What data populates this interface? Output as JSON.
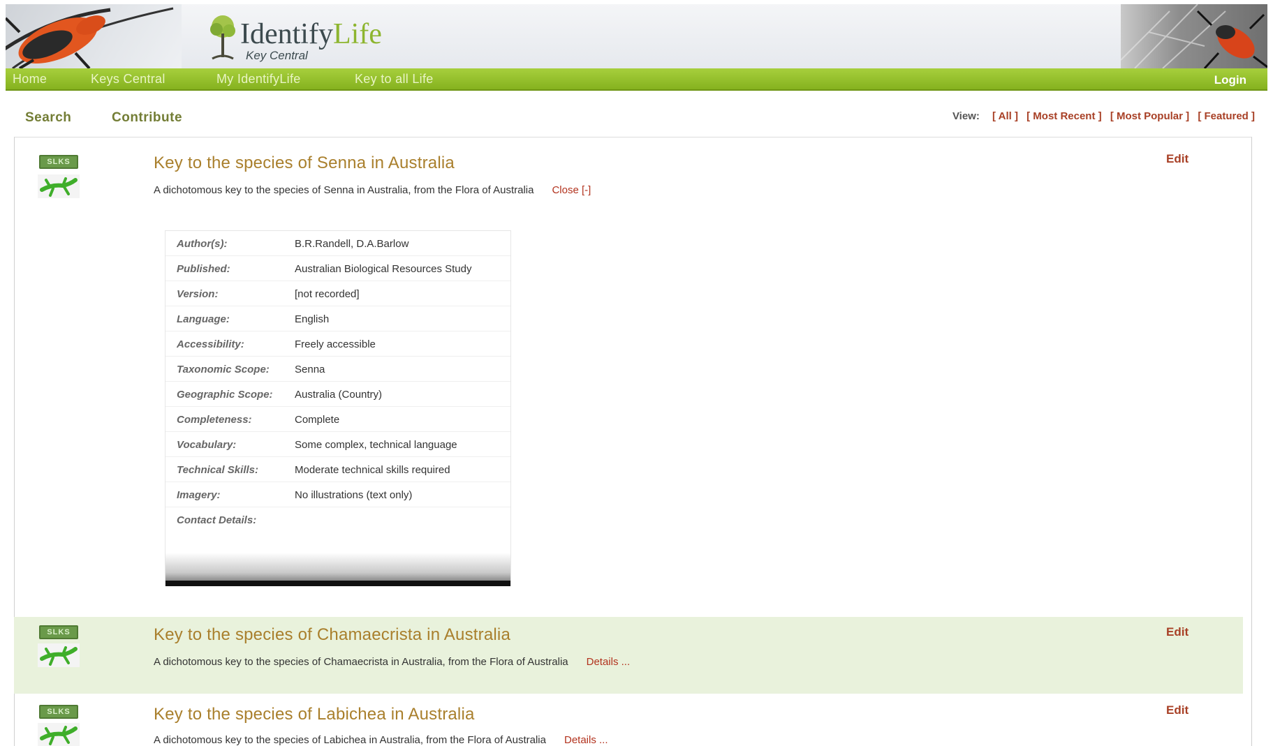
{
  "header": {
    "logo_part1": "Identify",
    "logo_part2": "Life",
    "logo_sub": "Key Central"
  },
  "nav": {
    "items": [
      "Home",
      "Keys Central",
      "My IdentifyLife",
      "Key to all Life"
    ],
    "login": "Login"
  },
  "subnav": {
    "items": [
      "Search",
      "Contribute"
    ]
  },
  "view": {
    "label": "View:",
    "options": [
      "[ All ]",
      "[ Most Recent ]",
      "[ Most Popular ]",
      "[ Featured ]"
    ]
  },
  "colors": {
    "nav_green": "#8db52f",
    "link_red": "#a84026",
    "title_gold": "#a97f2c",
    "alt_row": "#e9f2dc"
  },
  "entries": [
    {
      "badge": "SLKS",
      "icon": "lizard-icon",
      "title": "Key to the species of Senna in Australia",
      "description": "A dichotomous key to the species of Senna in Australia, from the Flora of Australia",
      "toggle": "Close [-]",
      "edit": "Edit",
      "details": [
        {
          "label": "Author(s):",
          "value": "B.R.Randell, D.A.Barlow"
        },
        {
          "label": "Published:",
          "value": " Australian Biological Resources Study"
        },
        {
          "label": "Version:",
          "value": "[not recorded]"
        },
        {
          "label": "Language:",
          "value": "English"
        },
        {
          "label": "Accessibility:",
          "value": "Freely accessible"
        },
        {
          "label": "Taxonomic Scope:",
          "value": "Senna"
        },
        {
          "label": "Geographic Scope:",
          "value": "Australia (Country)"
        },
        {
          "label": "Completeness:",
          "value": "Complete"
        },
        {
          "label": "Vocabulary:",
          "value": "Some complex, technical language"
        },
        {
          "label": "Technical Skills:",
          "value": "Moderate technical skills required"
        },
        {
          "label": "Imagery:",
          "value": "No illustrations (text only)"
        },
        {
          "label": "Contact Details:",
          "value": ""
        }
      ]
    },
    {
      "badge": "SLKS",
      "icon": "lizard-icon",
      "title": "Key to the species of Chamaecrista in Australia",
      "description": "A dichotomous key to the species of Chamaecrista in Australia, from the Flora of Australia",
      "toggle": "Details ...",
      "edit": "Edit"
    },
    {
      "badge": "SLKS",
      "icon": "lizard-icon",
      "title": "Key to the species of Labichea in Australia",
      "description": "A dichotomous key to the species of Labichea in Australia, from the Flora of Australia",
      "toggle": "Details ...",
      "edit": "Edit"
    }
  ]
}
